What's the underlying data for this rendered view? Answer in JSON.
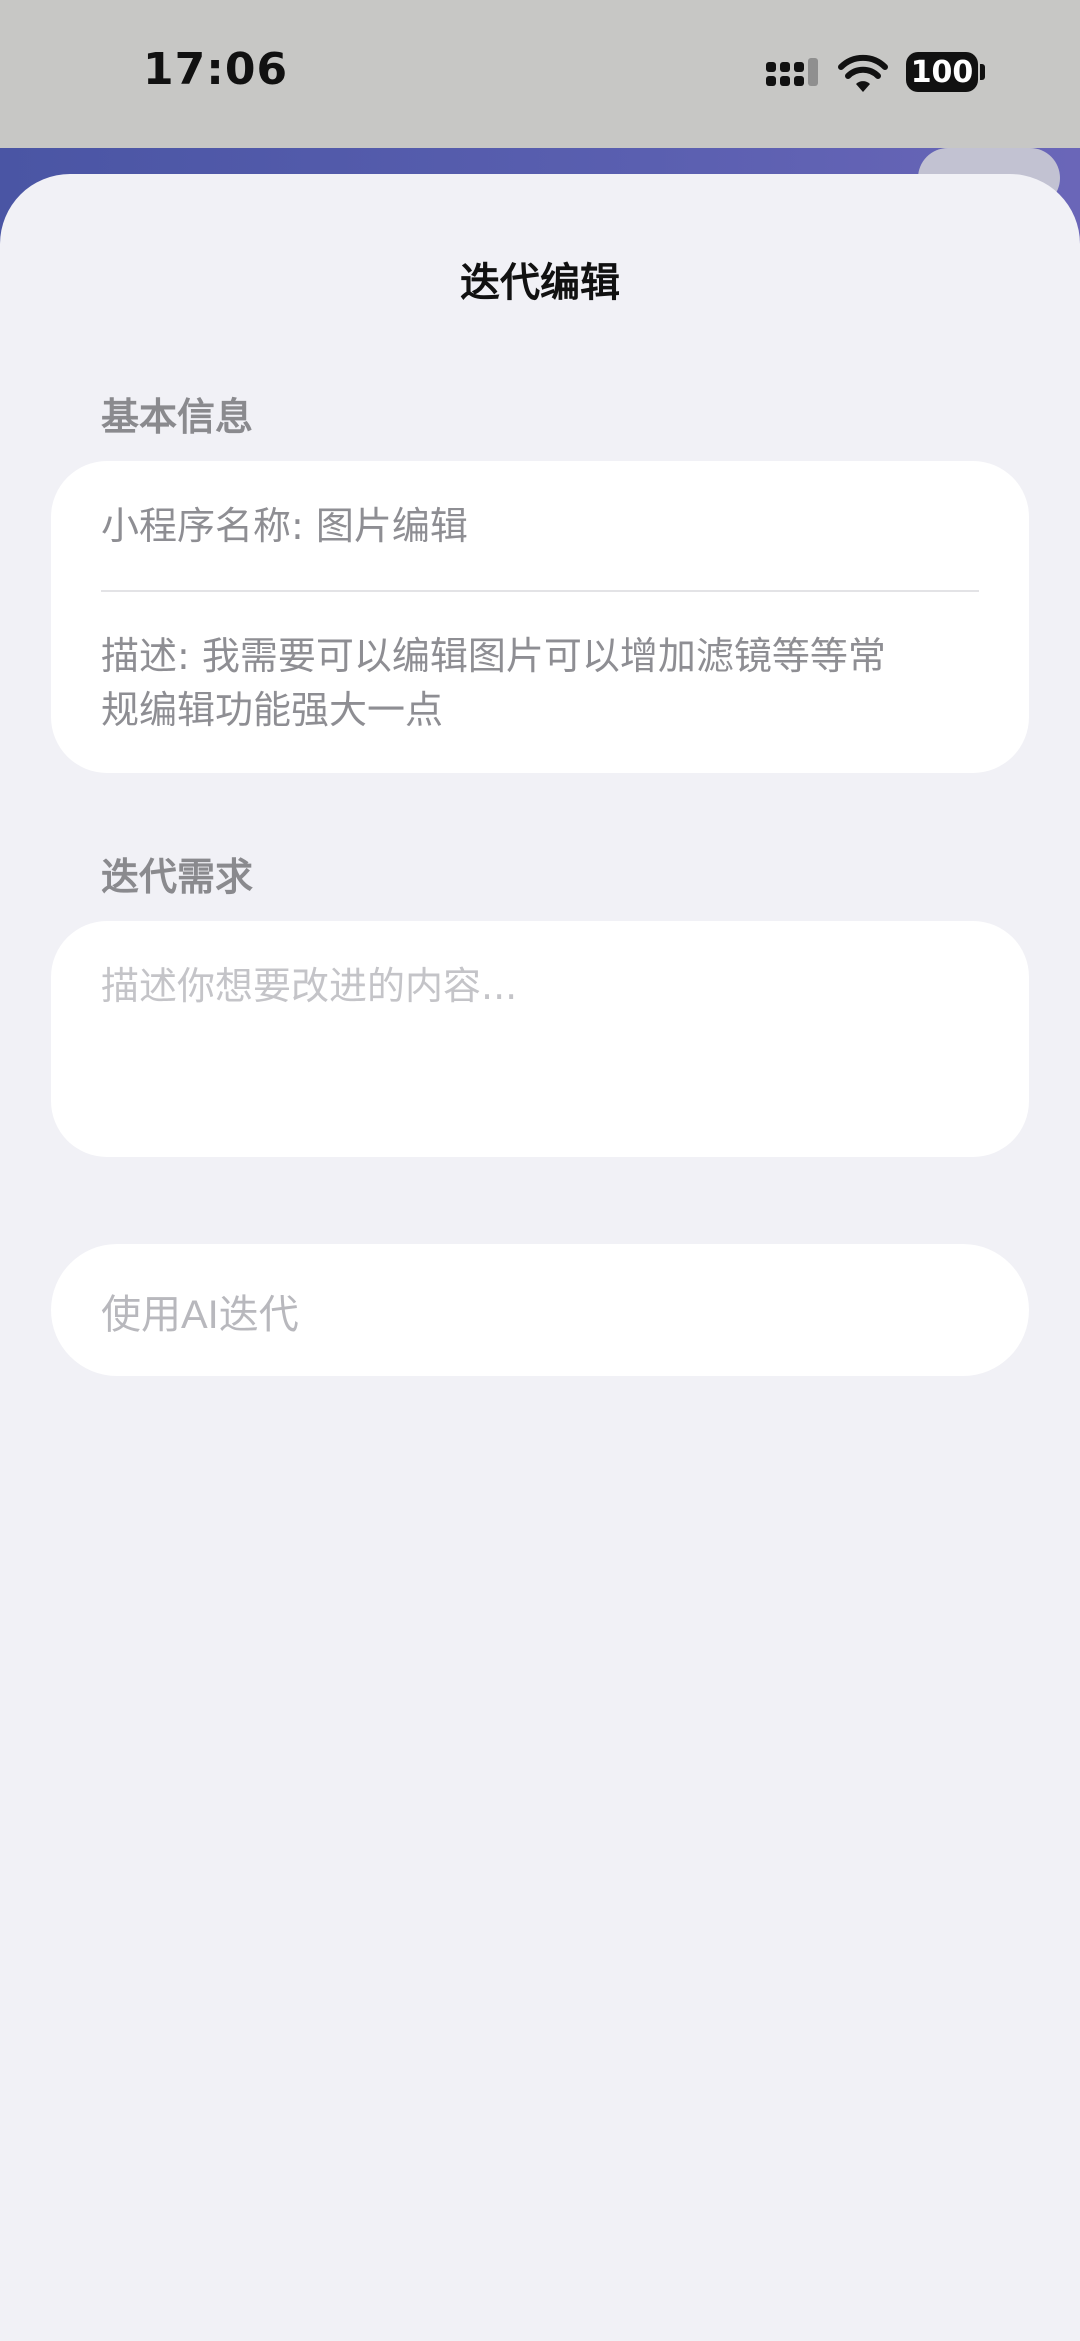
{
  "status_bar": {
    "time": "17:06",
    "battery": "100",
    "signal_icon": "cellular-signal-icon",
    "wifi_icon": "wifi-icon"
  },
  "sheet": {
    "title": "迭代编辑"
  },
  "basic_info": {
    "label": "基本信息",
    "name_line": "小程序名称: 图片编辑",
    "description_line1": "描述: 我需要可以编辑图片可以增加滤镜等等常",
    "description_line2": "规编辑功能强大一点"
  },
  "iteration": {
    "label": "迭代需求",
    "placeholder": "描述你想要改进的内容..."
  },
  "ai_button": {
    "label": "使用AI迭代"
  },
  "colors": {
    "sheet_bg": "#f1f1f6",
    "card_bg": "#ffffff",
    "accent_bg_app": "#4a55a4"
  }
}
